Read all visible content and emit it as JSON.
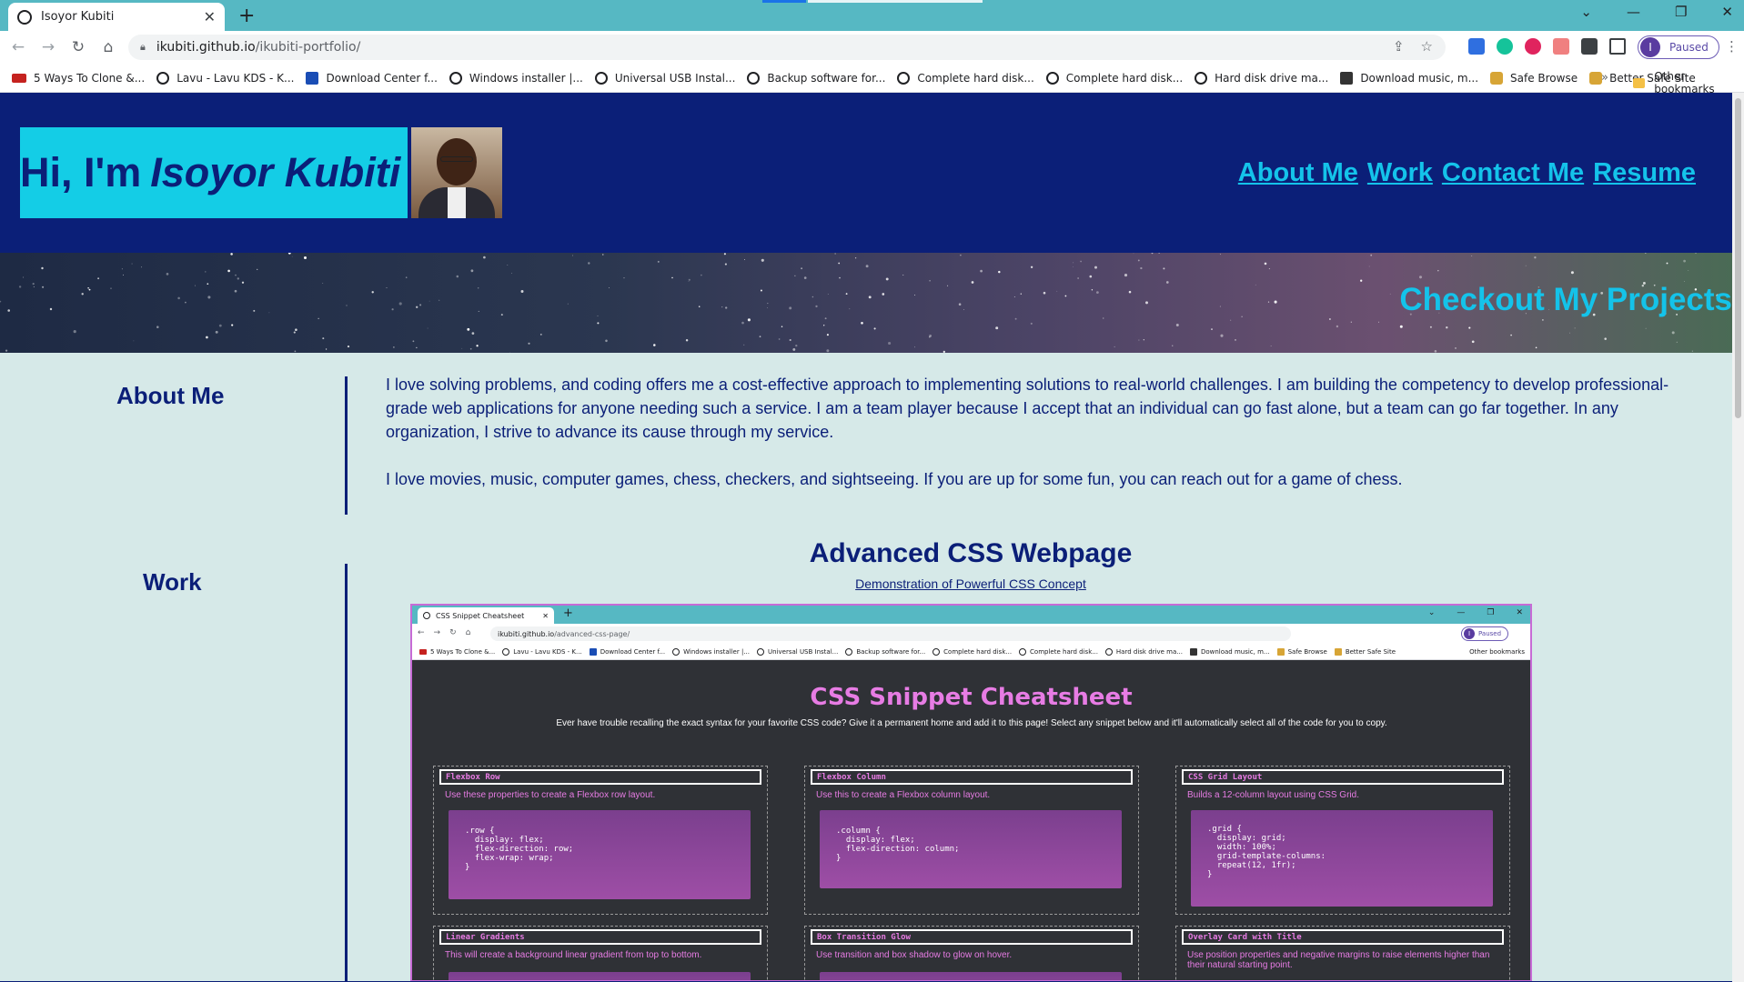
{
  "browser": {
    "tab_title": "Isoyor Kubiti",
    "url_host": "ikubiti.github.io",
    "url_path": "/ikubiti-portfolio/",
    "profile_label": "Paused",
    "profile_initial": "I",
    "bookmarks": [
      {
        "label": "5 Ways To Clone &...",
        "icon": "red"
      },
      {
        "label": "Lavu - Lavu KDS - K...",
        "icon": "globe"
      },
      {
        "label": "Download Center f...",
        "icon": "blue"
      },
      {
        "label": "Windows installer |...",
        "icon": "globe"
      },
      {
        "label": "Universal USB Instal...",
        "icon": "globe"
      },
      {
        "label": "Backup software for...",
        "icon": "globe"
      },
      {
        "label": "Complete hard disk...",
        "icon": "globe"
      },
      {
        "label": "Complete hard disk...",
        "icon": "globe"
      },
      {
        "label": "Hard disk drive ma...",
        "icon": "globe"
      },
      {
        "label": "Download music, m...",
        "icon": "dark"
      },
      {
        "label": "Safe Browse",
        "icon": "gold"
      },
      {
        "label": "Better Safe Site",
        "icon": "gold"
      }
    ],
    "bookmarks_more": "»",
    "other_bookmarks": "Other bookmarks"
  },
  "header": {
    "greeting": "Hi, I'm",
    "name": "Isoyor Kubiti",
    "nav": [
      "About Me",
      "Work",
      "Contact Me",
      "Resume"
    ]
  },
  "hero": {
    "title": "Checkout My Projects"
  },
  "about": {
    "title": "About Me",
    "paragraph1": "I love solving problems, and coding offers me a cost-effective approach to implementing solutions to real-world challenges. I am building the competency to develop professional-grade web applications for anyone needing such a service. I am a team player because I accept that an individual can go fast alone, but a team can go far together. In any organization, I strive to advance its cause through my service.",
    "paragraph2": "I love movies, music, computer games, chess, checkers, and sightseeing. If you are up for some fun, you can reach out for a game of chess."
  },
  "work": {
    "title": "Work",
    "project_title": "Advanced CSS Webpage",
    "project_link": "Demonstration of Powerful CSS Concept"
  },
  "screenshot": {
    "tab_title": "CSS Snippet Cheatsheet",
    "url_host": "ikubiti.github.io",
    "url_path": "/advanced-css-page/",
    "profile_label": "Paused",
    "profile_initial": "I",
    "bookmarks": [
      {
        "label": "5 Ways To Clone &...",
        "icon": "red"
      },
      {
        "label": "Lavu - Lavu KDS - K...",
        "icon": "globe"
      },
      {
        "label": "Download Center f...",
        "icon": "blue"
      },
      {
        "label": "Windows installer |...",
        "icon": "globe"
      },
      {
        "label": "Universal USB Instal...",
        "icon": "globe"
      },
      {
        "label": "Backup software for...",
        "icon": "globe"
      },
      {
        "label": "Complete hard disk...",
        "icon": "globe"
      },
      {
        "label": "Complete hard disk...",
        "icon": "globe"
      },
      {
        "label": "Hard disk drive ma...",
        "icon": "globe"
      },
      {
        "label": "Download music, m...",
        "icon": "dark"
      },
      {
        "label": "Safe Browse",
        "icon": "gold"
      },
      {
        "label": "Better Safe Site",
        "icon": "gold"
      }
    ],
    "other_bookmarks": "Other bookmarks",
    "page_title": "CSS Snippet Cheatsheet",
    "page_subtitle": "Ever have trouble recalling the exact syntax for your favorite CSS code? Give it a permanent home and add it to this page! Select any snippet below and it'll automatically select all of the code for you to copy.",
    "cards": [
      {
        "title": "Flexbox Row",
        "desc": "Use these properties to create a Flexbox row layout.",
        "code": ".row {\n  display: flex;\n  flex-direction: row;\n  flex-wrap: wrap;\n}"
      },
      {
        "title": "Flexbox Column",
        "desc": "Use this to create a Flexbox column layout.",
        "code": ".column {\n  display: flex;\n  flex-direction: column;\n}"
      },
      {
        "title": "CSS Grid Layout",
        "desc": "Builds a 12-column layout using CSS Grid.",
        "code": ".grid {\n  display: grid;\n  width: 100%;\n  grid-template-columns:\n  repeat(12, 1fr);\n}"
      },
      {
        "title": "Linear Gradients",
        "desc": "This will create a background linear gradient from top to bottom.",
        "code": ""
      },
      {
        "title": "Box Transition Glow",
        "desc": "Use transition and box shadow to glow on hover.",
        "code": ""
      },
      {
        "title": "Overlay Card with Title",
        "desc": "Use position properties and negative margins to raise elements higher than their natural starting point.",
        "code": ""
      }
    ]
  },
  "colors": {
    "header_bg": "#0b1f78",
    "accent": "#14c3ea",
    "page_bg": "#d6e9e8",
    "cheatsheet_accent": "#e77ce4"
  }
}
